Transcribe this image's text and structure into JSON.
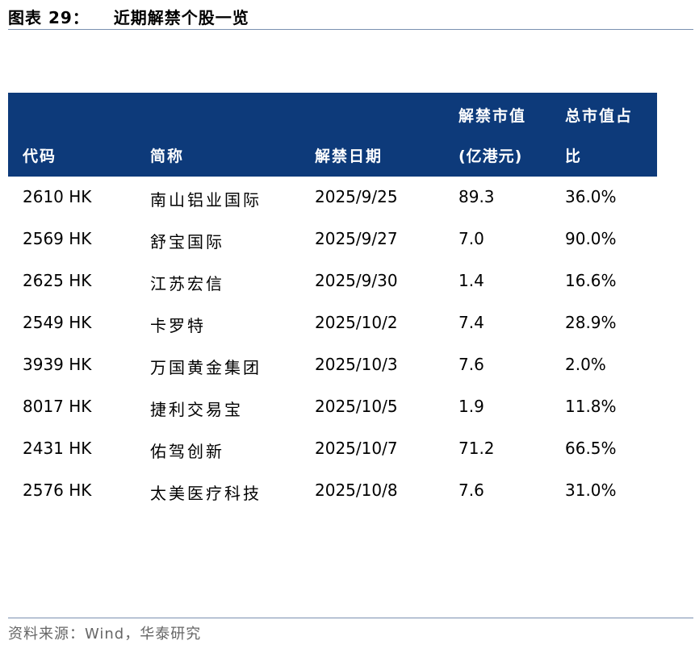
{
  "figure": {
    "title_num": "图表 29：",
    "title_text": "近期解禁个股一览"
  },
  "table": {
    "headers": {
      "code": "代码",
      "name": "简称",
      "date": "解禁日期",
      "value_line1": "解禁市值",
      "value_line2": "(亿港元)",
      "pct_line1": "总市值占",
      "pct_line2": "比"
    },
    "rows": [
      {
        "code": "2610 HK",
        "name": "南山铝业国际",
        "date": "2025/9/25",
        "value": "89.3",
        "pct": "36.0%"
      },
      {
        "code": "2569 HK",
        "name": "舒宝国际",
        "date": "2025/9/27",
        "value": "7.0",
        "pct": "90.0%"
      },
      {
        "code": "2625 HK",
        "name": "江苏宏信",
        "date": "2025/9/30",
        "value": "1.4",
        "pct": "16.6%"
      },
      {
        "code": "2549 HK",
        "name": "卡罗特",
        "date": "2025/10/2",
        "value": "7.4",
        "pct": "28.9%"
      },
      {
        "code": "3939 HK",
        "name": "万国黄金集团",
        "date": "2025/10/3",
        "value": "7.6",
        "pct": "2.0%"
      },
      {
        "code": "8017 HK",
        "name": "捷利交易宝",
        "date": "2025/10/5",
        "value": "1.9",
        "pct": "11.8%"
      },
      {
        "code": "2431 HK",
        "name": "佑驾创新",
        "date": "2025/10/7",
        "value": "71.2",
        "pct": "66.5%"
      },
      {
        "code": "2576 HK",
        "name": "太美医疗科技",
        "date": "2025/10/8",
        "value": "7.6",
        "pct": "31.0%"
      }
    ]
  },
  "source": "资料来源：Wind，华泰研究",
  "colors": {
    "header_bg": "#0d3a7a",
    "rule": "#7a90b0",
    "source_text": "#666666"
  }
}
